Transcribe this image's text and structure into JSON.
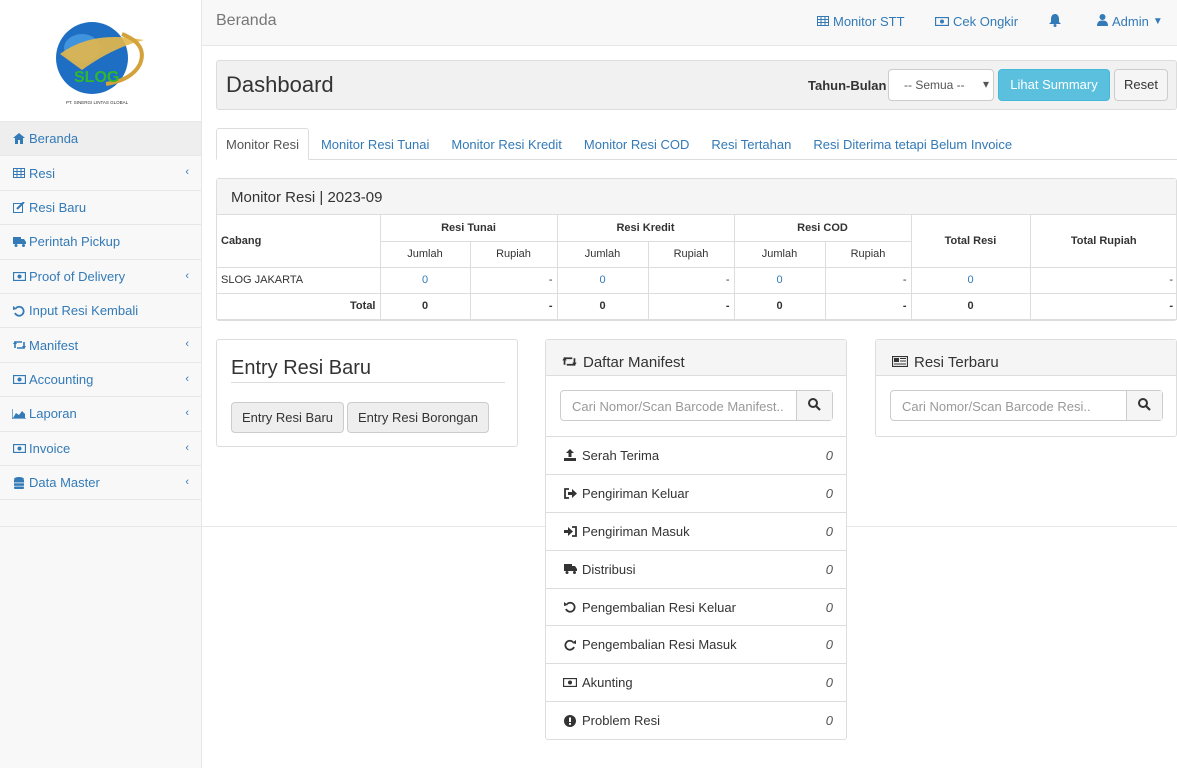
{
  "logo": {
    "brand": "SLOG",
    "company": "PT. SINERGI LINTAS GLOBAL"
  },
  "sidebar": {
    "items": [
      {
        "label": "Beranda",
        "icon": "home-icon"
      },
      {
        "label": "Resi",
        "icon": "table-icon"
      },
      {
        "label": "Resi Baru",
        "icon": "edit-icon"
      },
      {
        "label": "Perintah Pickup",
        "icon": "truck-icon"
      },
      {
        "label": "Proof of Delivery",
        "icon": "money-icon"
      },
      {
        "label": "Input Resi Kembali",
        "icon": "undo-icon"
      },
      {
        "label": "Manifest",
        "icon": "retweet-icon"
      },
      {
        "label": "Accounting",
        "icon": "money-icon"
      },
      {
        "label": "Laporan",
        "icon": "chart-icon"
      },
      {
        "label": "Invoice",
        "icon": "money-icon"
      },
      {
        "label": "Data Master",
        "icon": "database-icon"
      }
    ]
  },
  "topbar": {
    "breadcrumb": "Beranda",
    "monitor_stt": "Monitor STT",
    "cek_ongkir": "Cek Ongkir",
    "user": "Admin"
  },
  "header": {
    "title": "Dashboard",
    "filter_label": "Tahun-Bulan",
    "filter_value": "-- Semua --",
    "summary_button": "Lihat Summary",
    "reset_button": "Reset"
  },
  "tabs": [
    "Monitor Resi",
    "Monitor Resi Tunai",
    "Monitor Resi Kredit",
    "Monitor Resi COD",
    "Resi Tertahan",
    "Resi Diterima tetapi Belum Invoice"
  ],
  "monitor": {
    "title": "Monitor Resi",
    "period": "2023-09",
    "headers": {
      "cabang": "Cabang",
      "tunai": "Resi Tunai",
      "kredit": "Resi Kredit",
      "cod": "Resi COD",
      "jumlah": "Jumlah",
      "rupiah": "Rupiah",
      "total_resi": "Total Resi",
      "total_rupiah": "Total Rupiah"
    },
    "rows": [
      {
        "cabang": "SLOG JAKARTA",
        "tunai_jumlah": "0",
        "tunai_rupiah": "-",
        "kredit_jumlah": "0",
        "kredit_rupiah": "-",
        "cod_jumlah": "0",
        "cod_rupiah": "-",
        "total_resi": "0",
        "total_rupiah": "-"
      }
    ],
    "total": {
      "label": "Total",
      "tunai_jumlah": "0",
      "tunai_rupiah": "-",
      "kredit_jumlah": "0",
      "kredit_rupiah": "-",
      "cod_jumlah": "0",
      "cod_rupiah": "-",
      "total_resi": "0",
      "total_rupiah": "-"
    }
  },
  "entry": {
    "title": "Entry Resi Baru",
    "btn_baru": "Entry Resi Baru",
    "btn_borongan": "Entry Resi Borongan"
  },
  "manifest": {
    "title": "Daftar Manifest",
    "search_placeholder": "Cari Nomor/Scan Barcode Manifest..",
    "items": [
      {
        "label": "Serah Terima",
        "count": "0",
        "icon": "upload-icon"
      },
      {
        "label": "Pengiriman Keluar",
        "count": "0",
        "icon": "sign-out-icon"
      },
      {
        "label": "Pengiriman Masuk",
        "count": "0",
        "icon": "sign-in-icon"
      },
      {
        "label": "Distribusi",
        "count": "0",
        "icon": "truck-icon"
      },
      {
        "label": "Pengembalian Resi Keluar",
        "count": "0",
        "icon": "undo-icon"
      },
      {
        "label": "Pengembalian Resi Masuk",
        "count": "0",
        "icon": "redo-icon"
      },
      {
        "label": "Akunting",
        "count": "0",
        "icon": "money-icon"
      },
      {
        "label": "Problem Resi",
        "count": "0",
        "icon": "exclamation-circle-icon"
      }
    ]
  },
  "terbaru": {
    "title": "Resi Terbaru",
    "search_placeholder": "Cari Nomor/Scan Barcode Resi.."
  },
  "colors": {
    "link": "#337ab7",
    "info": "#5bc0de"
  }
}
